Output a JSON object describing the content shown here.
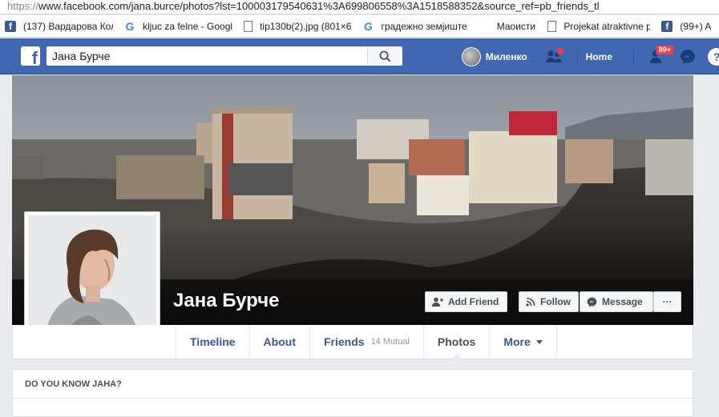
{
  "browser": {
    "url_scheme": "https://",
    "url_rest": "www.facebook.com/jana.burce/photos?lst=100003179540631%3A699806558%3A1518588352&source_ref=pb_friends_tl",
    "bookmarks": [
      {
        "icon": "facebook-icon",
        "label": "(137) Вардарова Кол"
      },
      {
        "icon": "google-icon",
        "label": "kljuc za felne - Googl"
      },
      {
        "icon": "document-icon",
        "label": "tip130b(2).jpg (801×6"
      },
      {
        "icon": "google-icon",
        "label": "градежно земјиште"
      },
      {
        "icon": "grid-icon",
        "label": "Маоисти"
      },
      {
        "icon": "document-icon",
        "label": "Projekat atraktivne p"
      },
      {
        "icon": "facebook-icon",
        "label": "(99+) A"
      }
    ]
  },
  "fb": {
    "search_value": "Јана Бурче",
    "user_name": "Миленко",
    "home_label": "Home",
    "friend_requests_badge": "99+",
    "colors": {
      "bar": "#4267b2",
      "link": "#365899",
      "badge": "#fa3e3e"
    }
  },
  "profile": {
    "name": "Јана Бурче",
    "actions": {
      "add_friend": "Add Friend",
      "follow": "Follow",
      "message": "Message",
      "more": "···"
    },
    "tabs": [
      {
        "label": "Timeline",
        "sub": ""
      },
      {
        "label": "About",
        "sub": ""
      },
      {
        "label": "Friends",
        "sub": "14 Mutual"
      },
      {
        "label": "Photos",
        "sub": ""
      },
      {
        "label": "More",
        "sub": ""
      }
    ],
    "active_tab": "Photos"
  },
  "know_box": {
    "title": "DO YOU KNOW JAHA?"
  }
}
